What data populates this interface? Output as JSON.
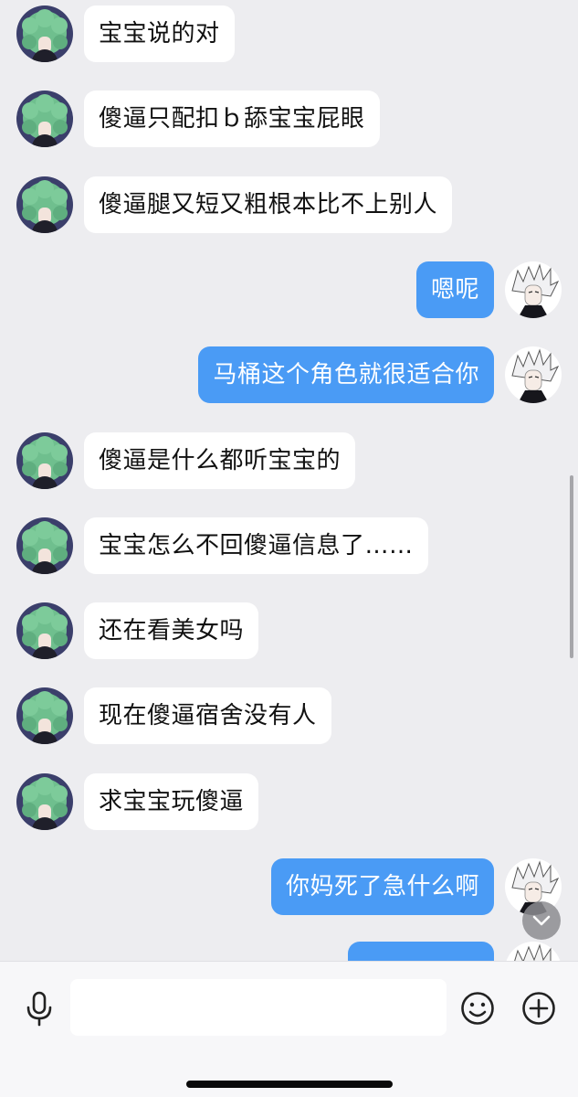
{
  "chat": {
    "messages": [
      {
        "sender": "them",
        "text": "宝宝说的对"
      },
      {
        "sender": "them",
        "text": "傻逼只配扣ｂ舔宝宝屁眼"
      },
      {
        "sender": "them",
        "text": "傻逼腿又短又粗根本比不上别人"
      },
      {
        "sender": "me",
        "text": "嗯呢"
      },
      {
        "sender": "me",
        "text": "马桶这个角色就很适合你"
      },
      {
        "sender": "them",
        "text": "傻逼是什么都听宝宝的"
      },
      {
        "sender": "them",
        "text": "宝宝怎么不回傻逼信息了……"
      },
      {
        "sender": "them",
        "text": "还在看美女吗"
      },
      {
        "sender": "them",
        "text": "现在傻逼宿舍没有人"
      },
      {
        "sender": "them",
        "text": "求宝宝玩傻逼"
      },
      {
        "sender": "me",
        "text": "你妈死了急什么啊"
      }
    ]
  },
  "colors": {
    "background": "#ededf0",
    "incoming_bubble": "#ffffff",
    "outgoing_bubble": "#4a9bf5",
    "incoming_avatar_hair": "#6fbf8e",
    "outgoing_avatar_bg": "#ffffff"
  },
  "icons": {
    "incoming_avatar": "green-curly-hair-anime-avatar",
    "outgoing_avatar": "white-spiky-hair-anime-avatar",
    "jump_to_bottom": "chevron-down-icon",
    "voice": "microphone-icon",
    "emoji": "smiley-icon",
    "more": "plus-circle-icon"
  },
  "composer": {
    "input_value": ""
  }
}
